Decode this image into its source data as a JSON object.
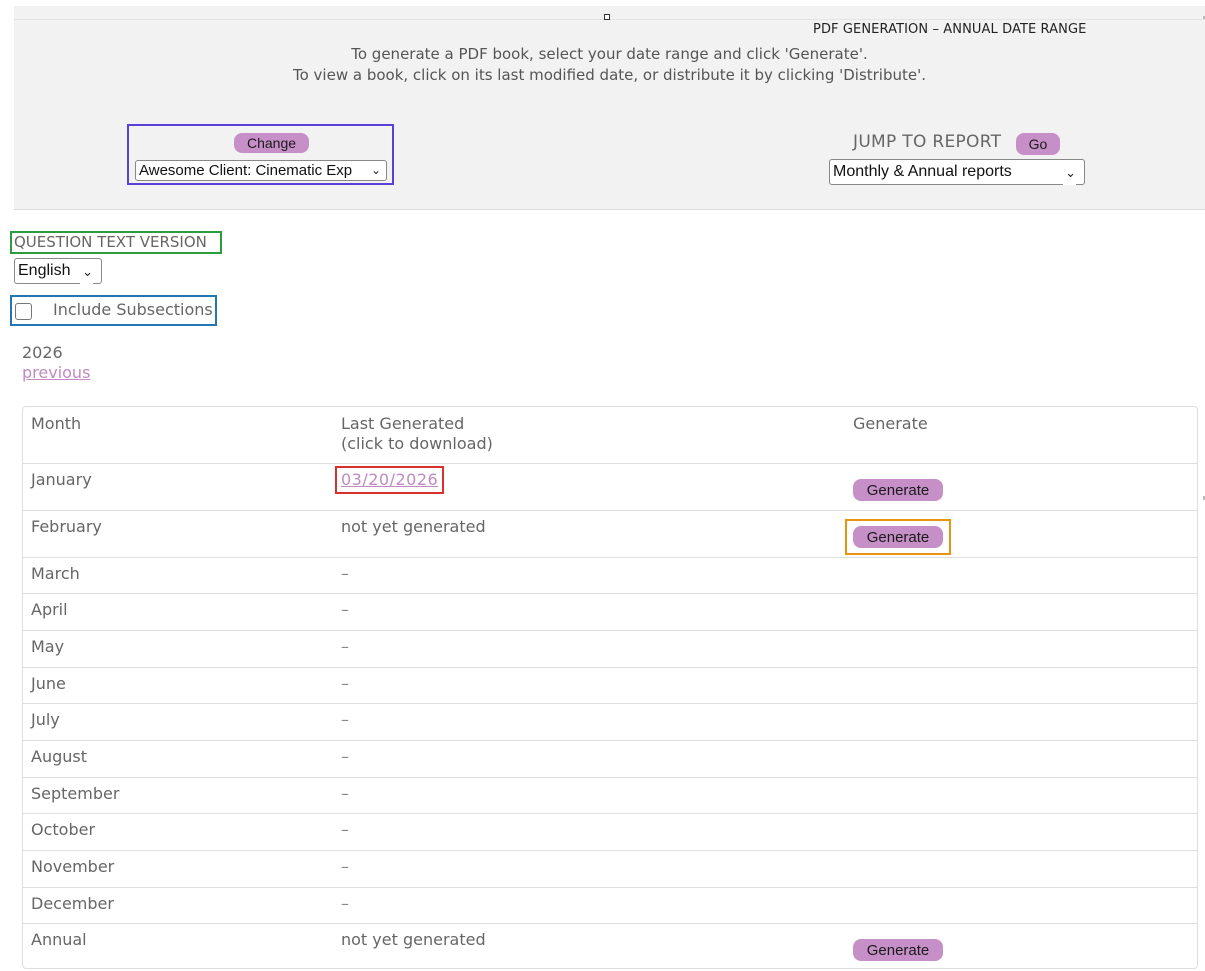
{
  "header": {
    "page_heading": "PDF GENERATION – ANNUAL DATE RANGE",
    "instruction_line1": "To generate a PDF book, select your date range and click 'Generate'.",
    "instruction_line2": "To view a book, click on its last modified date, or distribute it by clicking 'Distribute'.",
    "change_button": "Change",
    "client_select_value": "Awesome Client: Cinematic Exp",
    "jump_label": "JUMP TO REPORT",
    "go_button": "Go",
    "report_select_value": "Monthly & Annual reports"
  },
  "options": {
    "question_text_label": "QUESTION TEXT VERSION",
    "language_value": "English",
    "include_subsections_label": "Include Subsections",
    "include_subsections_checked": false
  },
  "year_nav": {
    "year": "2026",
    "previous_link": "previous"
  },
  "table": {
    "headers": {
      "month": "Month",
      "last_generated": "Last Generated\n(click to download)",
      "generate": "Generate"
    },
    "generate_button": "Generate",
    "rows": [
      {
        "month": "January",
        "last": "03/20/2026",
        "has_button": true
      },
      {
        "month": "February",
        "last": "not yet generated",
        "has_button": true
      },
      {
        "month": "March",
        "last": "–",
        "has_button": false
      },
      {
        "month": "April",
        "last": "–",
        "has_button": false
      },
      {
        "month": "May",
        "last": "–",
        "has_button": false
      },
      {
        "month": "June",
        "last": "–",
        "has_button": false
      },
      {
        "month": "July",
        "last": "–",
        "has_button": false
      },
      {
        "month": "August",
        "last": "–",
        "has_button": false
      },
      {
        "month": "September",
        "last": "–",
        "has_button": false
      },
      {
        "month": "October",
        "last": "–",
        "has_button": false
      },
      {
        "month": "November",
        "last": "–",
        "has_button": false
      },
      {
        "month": "December",
        "last": "–",
        "has_button": false
      },
      {
        "month": "Annual",
        "last": "not yet generated",
        "has_button": true
      }
    ]
  },
  "colors": {
    "button_bg": "#c78fc7",
    "link": "#c08bc0",
    "highlight_client": "#5b3fd6",
    "highlight_question": "#2a9d3f",
    "highlight_subsections": "#1f78b4",
    "highlight_date": "#d93030",
    "highlight_generate": "#e89410"
  }
}
